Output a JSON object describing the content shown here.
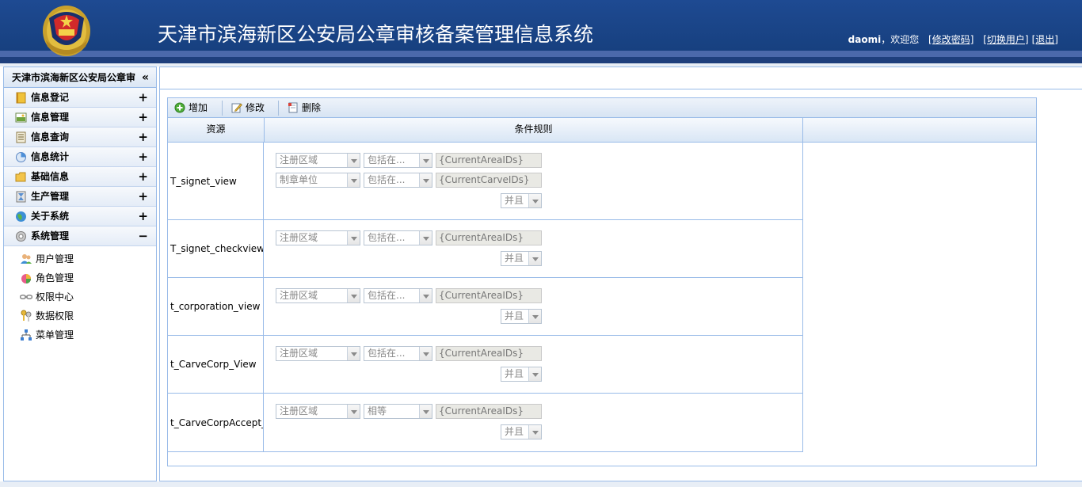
{
  "header": {
    "title": "天津市滨海新区公安局公章审核备案管理信息系统",
    "username": "daomi",
    "welcome": "，欢迎您",
    "change_password": "[修改密码]",
    "switch_user": "[切换用户]",
    "logout": "[退出]"
  },
  "sidebar": {
    "title": "天津市滨海新区公安局公章审",
    "collapse_symbol": "«",
    "sections": [
      {
        "label": "信息登记",
        "sign": "+",
        "icon": "notebook-icon"
      },
      {
        "label": "信息管理",
        "sign": "+",
        "icon": "image-icon"
      },
      {
        "label": "信息查询",
        "sign": "+",
        "icon": "document-list-icon"
      },
      {
        "label": "信息统计",
        "sign": "+",
        "icon": "chart-circle-icon"
      },
      {
        "label": "基础信息",
        "sign": "+",
        "icon": "folder-icon"
      },
      {
        "label": "生产管理",
        "sign": "+",
        "icon": "hourglass-icon"
      },
      {
        "label": "关于系统",
        "sign": "+",
        "icon": "globe-icon"
      },
      {
        "label": "系统管理",
        "sign": "−",
        "icon": "gear-icon"
      }
    ],
    "sub_items": [
      {
        "label": "用户管理",
        "icon": "users-icon"
      },
      {
        "label": "角色管理",
        "icon": "role-icon"
      },
      {
        "label": "权限中心",
        "icon": "chain-icon"
      },
      {
        "label": "数据权限",
        "icon": "keys-icon"
      },
      {
        "label": "菜单管理",
        "icon": "sitemap-icon"
      }
    ]
  },
  "toolbar": {
    "add_label": "增加",
    "edit_label": "修改",
    "delete_label": "删除"
  },
  "grid": {
    "columns": [
      "资源",
      "条件规则"
    ],
    "rows": [
      {
        "resource": "T_signet_view",
        "conditions": [
          {
            "field": "注册区域",
            "operator": "包括在...",
            "value": "{CurrentAreaIDs}"
          },
          {
            "field": "制章单位",
            "operator": "包括在...",
            "value": "{CurrentCarveIDs}"
          }
        ],
        "logic": "并且"
      },
      {
        "resource": "T_signet_checkview",
        "conditions": [
          {
            "field": "注册区域",
            "operator": "包括在...",
            "value": "{CurrentAreaIDs}"
          }
        ],
        "logic": "并且"
      },
      {
        "resource": "t_corporation_view",
        "conditions": [
          {
            "field": "注册区域",
            "operator": "包括在...",
            "value": "{CurrentAreaIDs}"
          }
        ],
        "logic": "并且"
      },
      {
        "resource": "t_CarveCorp_View",
        "conditions": [
          {
            "field": "注册区域",
            "operator": "包括在...",
            "value": "{CurrentAreaIDs}"
          }
        ],
        "logic": "并且"
      },
      {
        "resource": "t_CarveCorpAccept_",
        "conditions": [
          {
            "field": "注册区域",
            "operator": "相等",
            "value": "{CurrentAreaIDs}"
          }
        ],
        "logic": "并且"
      }
    ]
  },
  "colors": {
    "header_bg": "#1e4a92",
    "border": "#99bbe8",
    "header_text": "#ffffff"
  }
}
